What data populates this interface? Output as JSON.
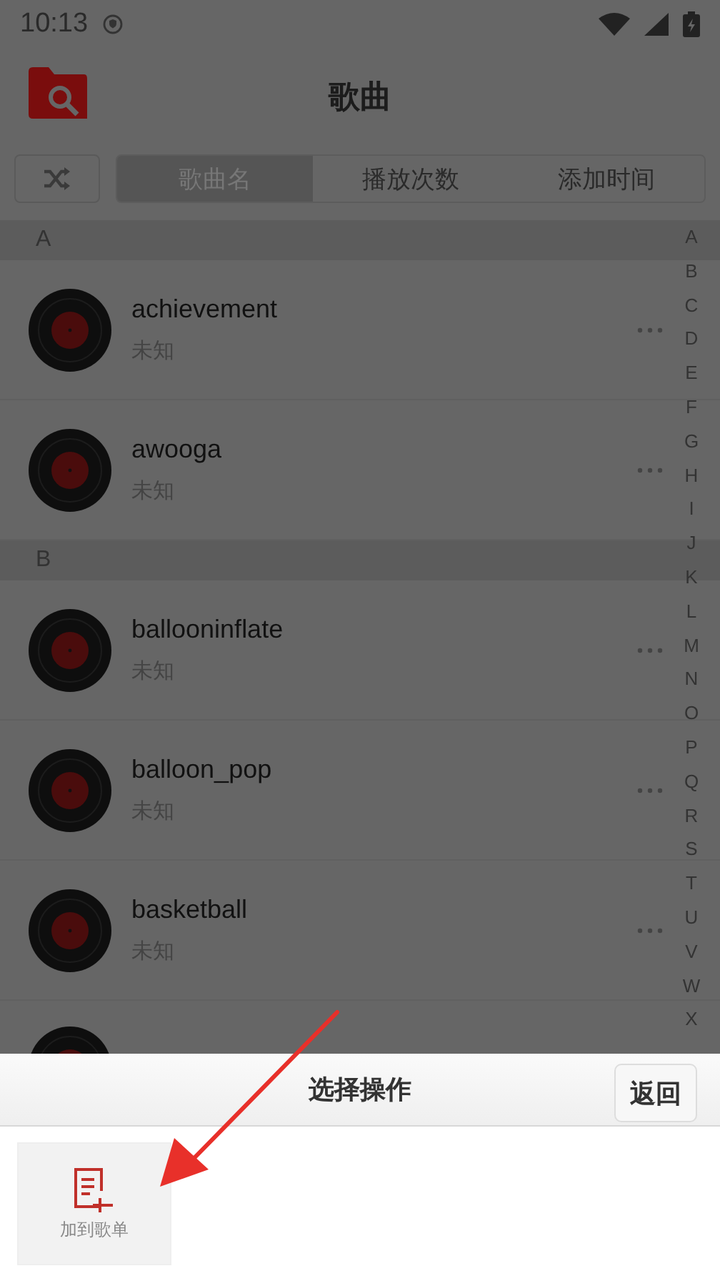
{
  "status_bar": {
    "time": "10:13"
  },
  "header": {
    "title": "歌曲"
  },
  "sort_tabs": [
    {
      "label": "歌曲名",
      "selected": true
    },
    {
      "label": "播放次数",
      "selected": false
    },
    {
      "label": "添加时间",
      "selected": false
    }
  ],
  "sections": [
    {
      "letter": "A",
      "songs": [
        {
          "title": "achievement",
          "artist": "未知"
        },
        {
          "title": "awooga",
          "artist": "未知"
        }
      ]
    },
    {
      "letter": "B",
      "songs": [
        {
          "title": "ballooninflate",
          "artist": "未知"
        },
        {
          "title": "balloon_pop",
          "artist": "未知"
        },
        {
          "title": "basketball",
          "artist": "未知"
        }
      ]
    }
  ],
  "index_letters": [
    "A",
    "B",
    "C",
    "D",
    "E",
    "F",
    "G",
    "H",
    "I",
    "J",
    "K",
    "L",
    "M",
    "N",
    "O",
    "P",
    "Q",
    "R",
    "S",
    "T",
    "U",
    "V",
    "W",
    "X"
  ],
  "bottom_sheet": {
    "title": "选择操作",
    "back_button": "返回",
    "actions": [
      {
        "label": "加到歌单"
      }
    ]
  }
}
